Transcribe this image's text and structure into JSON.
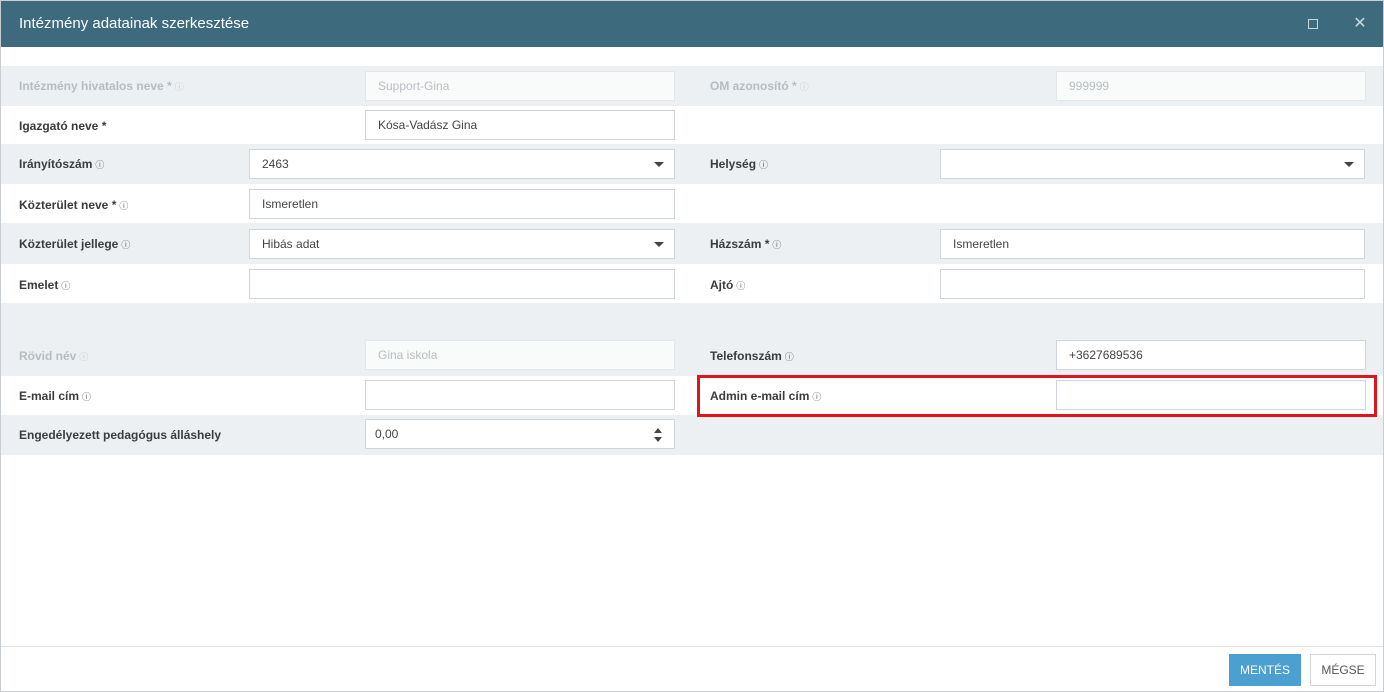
{
  "dialog": {
    "title": "Intézmény adatainak szerkesztése",
    "maximize_icon": "maximize-icon",
    "close_icon": "close-icon"
  },
  "info_marker": "ⓘ",
  "fields": {
    "official_name": {
      "label": "Intézmény hivatalos neve *",
      "value": "Support-Gina"
    },
    "om_id": {
      "label": "OM azonosító *",
      "value": "999999"
    },
    "director": {
      "label": "Igazgató neve *",
      "value": "Kósa-Vadász Gina"
    },
    "zip": {
      "label": "Irányítószám",
      "value": "2463"
    },
    "city": {
      "label": "Helység",
      "value": ""
    },
    "street_name": {
      "label": "Közterület neve *",
      "value": "Ismeretlen"
    },
    "street_type": {
      "label": "Közterület jellege",
      "value": "Hibás adat"
    },
    "house_number": {
      "label": "Házszám *",
      "value": "Ismeretlen"
    },
    "floor": {
      "label": "Emelet",
      "value": ""
    },
    "door": {
      "label": "Ajtó",
      "value": ""
    },
    "short_name": {
      "label": "Rövid név",
      "value": "Gina iskola"
    },
    "phone": {
      "label": "Telefonszám",
      "value": "+3627689536"
    },
    "email": {
      "label": "E-mail cím",
      "value": ""
    },
    "admin_email": {
      "label": "Admin e-mail cím",
      "value": ""
    },
    "teacher_positions": {
      "label": "Engedélyezett pedagógus álláshely",
      "value": "0,00"
    }
  },
  "footer": {
    "save_label": "MENTÉS",
    "cancel_label": "MÉGSE"
  },
  "colors": {
    "titlebar": "#3d6a7c",
    "row_stripe": "#ecf0f3",
    "save_button": "#4b9fd1",
    "highlight": "#e0141e"
  }
}
